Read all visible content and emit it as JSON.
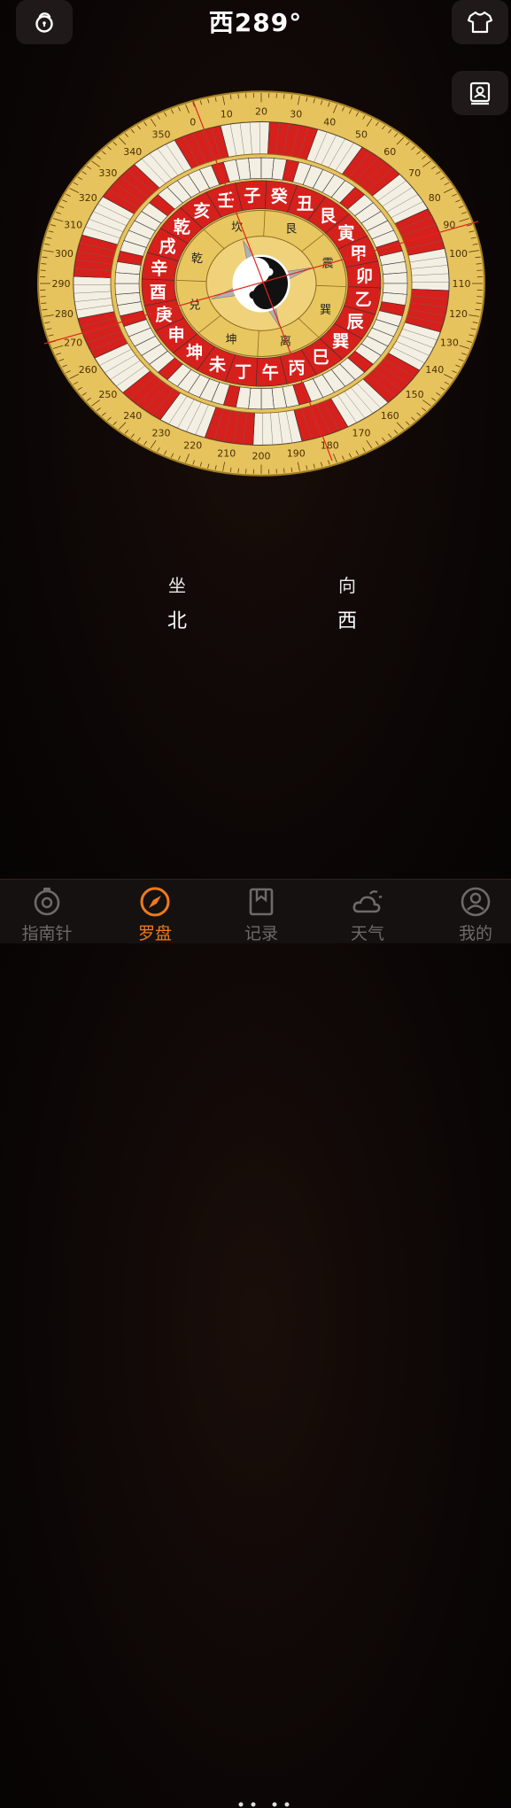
{
  "header": {
    "heading": "西289°",
    "icons": [
      "unlock-icon",
      "shirt-icon",
      "profile-card-icon"
    ]
  },
  "compass": {
    "degree_labels": [
      "0",
      "10",
      "20",
      "30",
      "40",
      "50",
      "60",
      "70",
      "80",
      "90",
      "100",
      "110",
      "120",
      "130",
      "140",
      "150",
      "160",
      "170",
      "180",
      "190",
      "200",
      "210",
      "220",
      "230",
      "240",
      "250",
      "260",
      "270",
      "280",
      "290",
      "300",
      "310",
      "320",
      "330",
      "340",
      "350"
    ],
    "inner_ring": [
      "壬",
      "子",
      "癸",
      "丑",
      "艮",
      "寅",
      "甲",
      "卯",
      "乙",
      "辰",
      "巽",
      "巳",
      "丙",
      "午",
      "丁",
      "未",
      "坤",
      "申",
      "庚",
      "酉",
      "辛",
      "戌",
      "乾",
      "亥"
    ],
    "trigrams": [
      "坎",
      "艮",
      "震",
      "巽",
      "离",
      "坤",
      "兑",
      "乾"
    ],
    "colors": {
      "gold": "#e7c35e",
      "red": "#d6201c",
      "white": "#f4efe3",
      "black": "#111111"
    }
  },
  "result": {
    "sit_label": "坐",
    "sit_value": "北",
    "face_label": "向",
    "face_value": "西"
  },
  "tabs": [
    {
      "label": "指南针",
      "icon": "compass-icon",
      "active": false
    },
    {
      "label": "罗盘",
      "icon": "luopan-icon",
      "active": true
    },
    {
      "label": "记录",
      "icon": "bookmark-icon",
      "active": false
    },
    {
      "label": "天气",
      "icon": "weather-icon",
      "active": false
    },
    {
      "label": "我的",
      "icon": "user-icon",
      "active": false
    }
  ],
  "accent_color": "#f07a1a"
}
